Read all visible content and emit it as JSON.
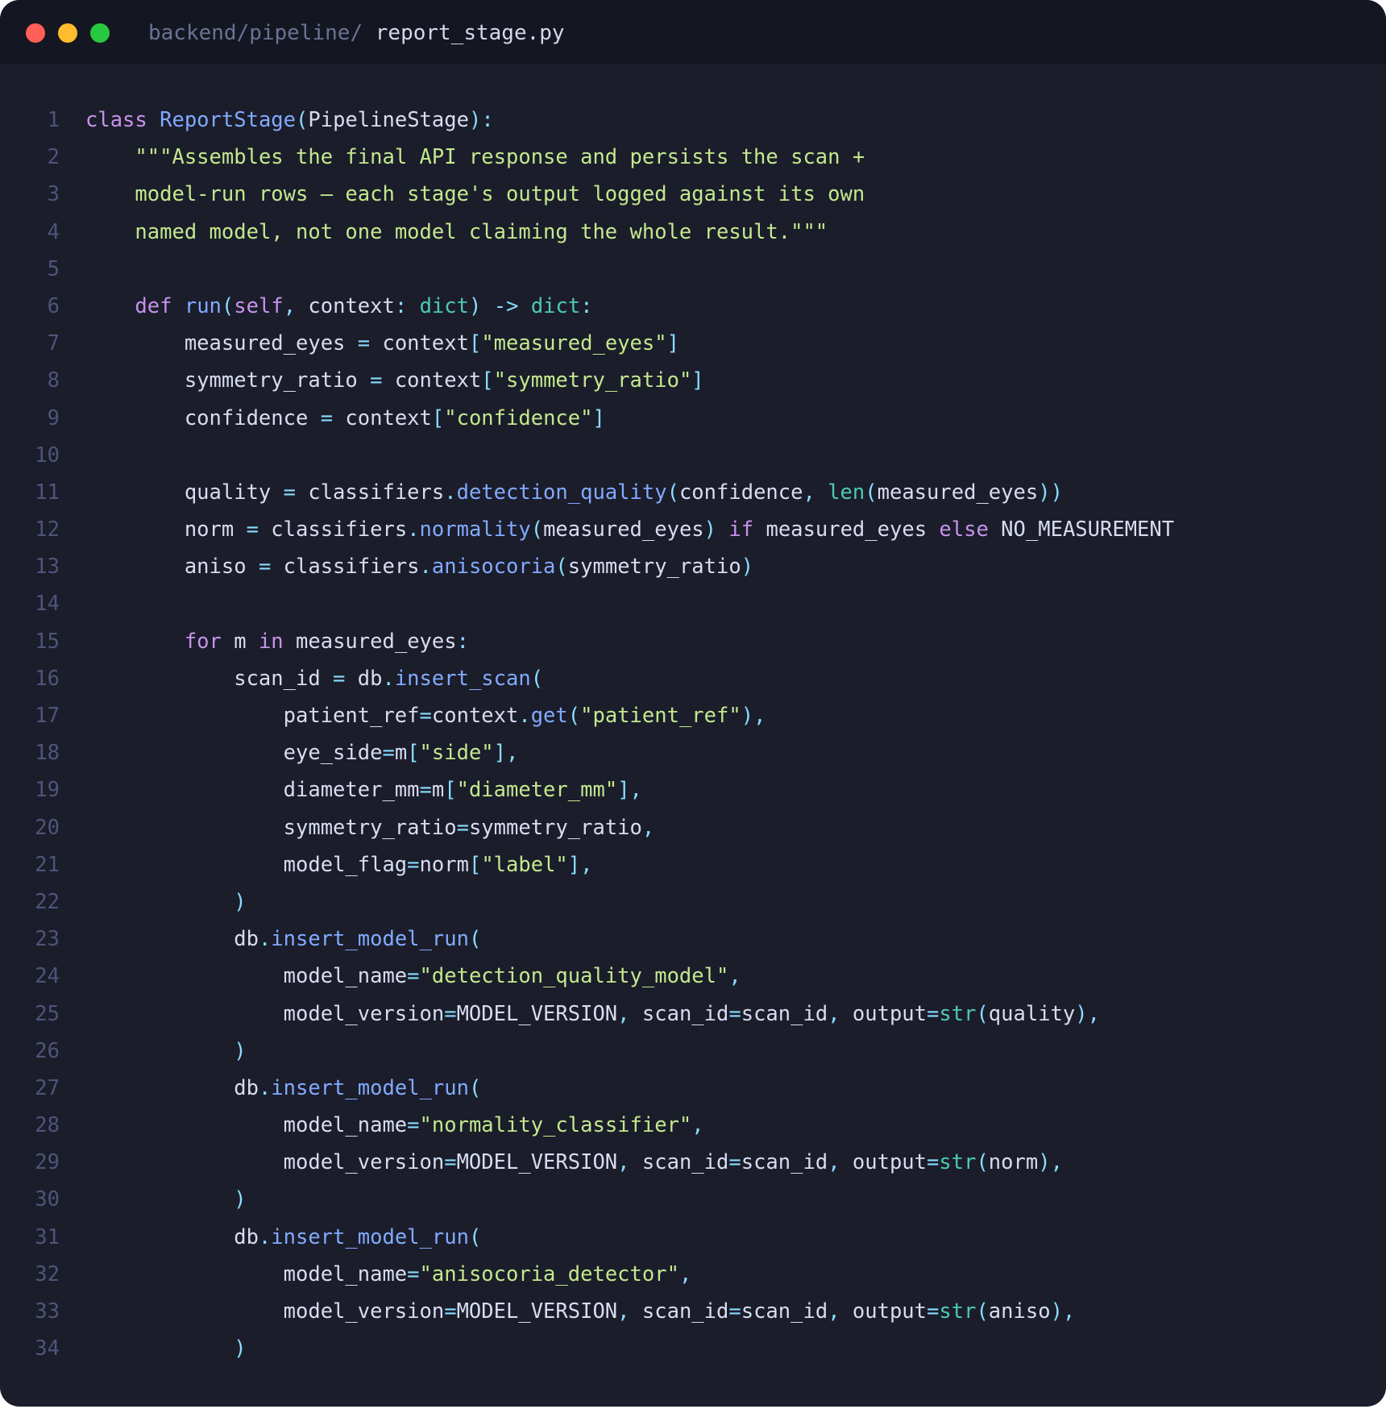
{
  "window": {
    "controls": [
      "close",
      "minimize",
      "maximize"
    ],
    "path_dir": "backend/pipeline/",
    "path_file": "report_stage.py"
  },
  "editor": {
    "lines": [
      {
        "n": "1",
        "tokens": [
          [
            "kw",
            "class"
          ],
          [
            "id",
            " "
          ],
          [
            "cls",
            "ReportStage"
          ],
          [
            "p",
            "("
          ],
          [
            "id",
            "PipelineStage"
          ],
          [
            "p",
            "):"
          ]
        ]
      },
      {
        "n": "2",
        "tokens": [
          [
            "id",
            "    "
          ],
          [
            "str",
            "\"\"\"Assembles the final API response and persists the scan +"
          ]
        ]
      },
      {
        "n": "3",
        "tokens": [
          [
            "id",
            "    "
          ],
          [
            "str",
            "model-run rows — each stage's output logged against its own"
          ]
        ]
      },
      {
        "n": "4",
        "tokens": [
          [
            "id",
            "    "
          ],
          [
            "str",
            "named model, not one model claiming the whole result.\"\"\""
          ]
        ]
      },
      {
        "n": "5",
        "tokens": []
      },
      {
        "n": "6",
        "tokens": [
          [
            "id",
            "    "
          ],
          [
            "kw",
            "def"
          ],
          [
            "id",
            " "
          ],
          [
            "fn",
            "run"
          ],
          [
            "p",
            "("
          ],
          [
            "kw",
            "self"
          ],
          [
            "p",
            ","
          ],
          [
            "id",
            " context"
          ],
          [
            "p",
            ":"
          ],
          [
            "id",
            " "
          ],
          [
            "bi",
            "dict"
          ],
          [
            "p",
            ")"
          ],
          [
            "id",
            " "
          ],
          [
            "p",
            "->"
          ],
          [
            "id",
            " "
          ],
          [
            "bi",
            "dict"
          ],
          [
            "p",
            ":"
          ]
        ]
      },
      {
        "n": "7",
        "tokens": [
          [
            "id",
            "        measured_eyes "
          ],
          [
            "p",
            "="
          ],
          [
            "id",
            " context"
          ],
          [
            "p",
            "["
          ],
          [
            "str",
            "\"measured_eyes\""
          ],
          [
            "p",
            "]"
          ]
        ]
      },
      {
        "n": "8",
        "tokens": [
          [
            "id",
            "        symmetry_ratio "
          ],
          [
            "p",
            "="
          ],
          [
            "id",
            " context"
          ],
          [
            "p",
            "["
          ],
          [
            "str",
            "\"symmetry_ratio\""
          ],
          [
            "p",
            "]"
          ]
        ]
      },
      {
        "n": "9",
        "tokens": [
          [
            "id",
            "        confidence "
          ],
          [
            "p",
            "="
          ],
          [
            "id",
            " context"
          ],
          [
            "p",
            "["
          ],
          [
            "str",
            "\"confidence\""
          ],
          [
            "p",
            "]"
          ]
        ]
      },
      {
        "n": "10",
        "tokens": []
      },
      {
        "n": "11",
        "tokens": [
          [
            "id",
            "        quality "
          ],
          [
            "p",
            "="
          ],
          [
            "id",
            " classifiers"
          ],
          [
            "p",
            "."
          ],
          [
            "fn",
            "detection_quality"
          ],
          [
            "p",
            "("
          ],
          [
            "id",
            "confidence"
          ],
          [
            "p",
            ","
          ],
          [
            "id",
            " "
          ],
          [
            "bi",
            "len"
          ],
          [
            "p",
            "("
          ],
          [
            "id",
            "measured_eyes"
          ],
          [
            "p",
            "))"
          ]
        ]
      },
      {
        "n": "12",
        "tokens": [
          [
            "id",
            "        norm "
          ],
          [
            "p",
            "="
          ],
          [
            "id",
            " classifiers"
          ],
          [
            "p",
            "."
          ],
          [
            "fn",
            "normality"
          ],
          [
            "p",
            "("
          ],
          [
            "id",
            "measured_eyes"
          ],
          [
            "p",
            ")"
          ],
          [
            "id",
            " "
          ],
          [
            "kw",
            "if"
          ],
          [
            "id",
            " measured_eyes "
          ],
          [
            "kw",
            "else"
          ],
          [
            "id",
            " NO_MEASUREMENT"
          ]
        ]
      },
      {
        "n": "13",
        "tokens": [
          [
            "id",
            "        aniso "
          ],
          [
            "p",
            "="
          ],
          [
            "id",
            " classifiers"
          ],
          [
            "p",
            "."
          ],
          [
            "fn",
            "anisocoria"
          ],
          [
            "p",
            "("
          ],
          [
            "id",
            "symmetry_ratio"
          ],
          [
            "p",
            ")"
          ]
        ]
      },
      {
        "n": "14",
        "tokens": []
      },
      {
        "n": "15",
        "tokens": [
          [
            "id",
            "        "
          ],
          [
            "kw",
            "for"
          ],
          [
            "id",
            " m "
          ],
          [
            "kw",
            "in"
          ],
          [
            "id",
            " measured_eyes"
          ],
          [
            "p",
            ":"
          ]
        ]
      },
      {
        "n": "16",
        "tokens": [
          [
            "id",
            "            scan_id "
          ],
          [
            "p",
            "="
          ],
          [
            "id",
            " db"
          ],
          [
            "p",
            "."
          ],
          [
            "fn",
            "insert_scan"
          ],
          [
            "p",
            "("
          ]
        ]
      },
      {
        "n": "17",
        "tokens": [
          [
            "id",
            "                patient_ref"
          ],
          [
            "p",
            "="
          ],
          [
            "id",
            "context"
          ],
          [
            "p",
            "."
          ],
          [
            "fn",
            "get"
          ],
          [
            "p",
            "("
          ],
          [
            "str",
            "\"patient_ref\""
          ],
          [
            "p",
            "),"
          ]
        ]
      },
      {
        "n": "18",
        "tokens": [
          [
            "id",
            "                eye_side"
          ],
          [
            "p",
            "="
          ],
          [
            "id",
            "m"
          ],
          [
            "p",
            "["
          ],
          [
            "str",
            "\"side\""
          ],
          [
            "p",
            "],"
          ]
        ]
      },
      {
        "n": "19",
        "tokens": [
          [
            "id",
            "                diameter_mm"
          ],
          [
            "p",
            "="
          ],
          [
            "id",
            "m"
          ],
          [
            "p",
            "["
          ],
          [
            "str",
            "\"diameter_mm\""
          ],
          [
            "p",
            "],"
          ]
        ]
      },
      {
        "n": "20",
        "tokens": [
          [
            "id",
            "                symmetry_ratio"
          ],
          [
            "p",
            "="
          ],
          [
            "id",
            "symmetry_ratio"
          ],
          [
            "p",
            ","
          ]
        ]
      },
      {
        "n": "21",
        "tokens": [
          [
            "id",
            "                model_flag"
          ],
          [
            "p",
            "="
          ],
          [
            "id",
            "norm"
          ],
          [
            "p",
            "["
          ],
          [
            "str",
            "\"label\""
          ],
          [
            "p",
            "],"
          ]
        ]
      },
      {
        "n": "22",
        "tokens": [
          [
            "id",
            "            "
          ],
          [
            "p",
            ")"
          ]
        ]
      },
      {
        "n": "23",
        "tokens": [
          [
            "id",
            "            db"
          ],
          [
            "p",
            "."
          ],
          [
            "fn",
            "insert_model_run"
          ],
          [
            "p",
            "("
          ]
        ]
      },
      {
        "n": "24",
        "tokens": [
          [
            "id",
            "                model_name"
          ],
          [
            "p",
            "="
          ],
          [
            "str",
            "\"detection_quality_model\""
          ],
          [
            "p",
            ","
          ]
        ]
      },
      {
        "n": "25",
        "tokens": [
          [
            "id",
            "                model_version"
          ],
          [
            "p",
            "="
          ],
          [
            "id",
            "MODEL_VERSION"
          ],
          [
            "p",
            ","
          ],
          [
            "id",
            " scan_id"
          ],
          [
            "p",
            "="
          ],
          [
            "id",
            "scan_id"
          ],
          [
            "p",
            ","
          ],
          [
            "id",
            " output"
          ],
          [
            "p",
            "="
          ],
          [
            "bi",
            "str"
          ],
          [
            "p",
            "("
          ],
          [
            "id",
            "quality"
          ],
          [
            "p",
            "),"
          ]
        ]
      },
      {
        "n": "26",
        "tokens": [
          [
            "id",
            "            "
          ],
          [
            "p",
            ")"
          ]
        ]
      },
      {
        "n": "27",
        "tokens": [
          [
            "id",
            "            db"
          ],
          [
            "p",
            "."
          ],
          [
            "fn",
            "insert_model_run"
          ],
          [
            "p",
            "("
          ]
        ]
      },
      {
        "n": "28",
        "tokens": [
          [
            "id",
            "                model_name"
          ],
          [
            "p",
            "="
          ],
          [
            "str",
            "\"normality_classifier\""
          ],
          [
            "p",
            ","
          ]
        ]
      },
      {
        "n": "29",
        "tokens": [
          [
            "id",
            "                model_version"
          ],
          [
            "p",
            "="
          ],
          [
            "id",
            "MODEL_VERSION"
          ],
          [
            "p",
            ","
          ],
          [
            "id",
            " scan_id"
          ],
          [
            "p",
            "="
          ],
          [
            "id",
            "scan_id"
          ],
          [
            "p",
            ","
          ],
          [
            "id",
            " output"
          ],
          [
            "p",
            "="
          ],
          [
            "bi",
            "str"
          ],
          [
            "p",
            "("
          ],
          [
            "id",
            "norm"
          ],
          [
            "p",
            "),"
          ]
        ]
      },
      {
        "n": "30",
        "tokens": [
          [
            "id",
            "            "
          ],
          [
            "p",
            ")"
          ]
        ]
      },
      {
        "n": "31",
        "tokens": [
          [
            "id",
            "            db"
          ],
          [
            "p",
            "."
          ],
          [
            "fn",
            "insert_model_run"
          ],
          [
            "p",
            "("
          ]
        ]
      },
      {
        "n": "32",
        "tokens": [
          [
            "id",
            "                model_name"
          ],
          [
            "p",
            "="
          ],
          [
            "str",
            "\"anisocoria_detector\""
          ],
          [
            "p",
            ","
          ]
        ]
      },
      {
        "n": "33",
        "tokens": [
          [
            "id",
            "                model_version"
          ],
          [
            "p",
            "="
          ],
          [
            "id",
            "MODEL_VERSION"
          ],
          [
            "p",
            ","
          ],
          [
            "id",
            " scan_id"
          ],
          [
            "p",
            "="
          ],
          [
            "id",
            "scan_id"
          ],
          [
            "p",
            ","
          ],
          [
            "id",
            " output"
          ],
          [
            "p",
            "="
          ],
          [
            "bi",
            "str"
          ],
          [
            "p",
            "("
          ],
          [
            "id",
            "aniso"
          ],
          [
            "p",
            "),"
          ]
        ]
      },
      {
        "n": "34",
        "tokens": [
          [
            "id",
            "            "
          ],
          [
            "p",
            ")"
          ]
        ]
      }
    ]
  }
}
